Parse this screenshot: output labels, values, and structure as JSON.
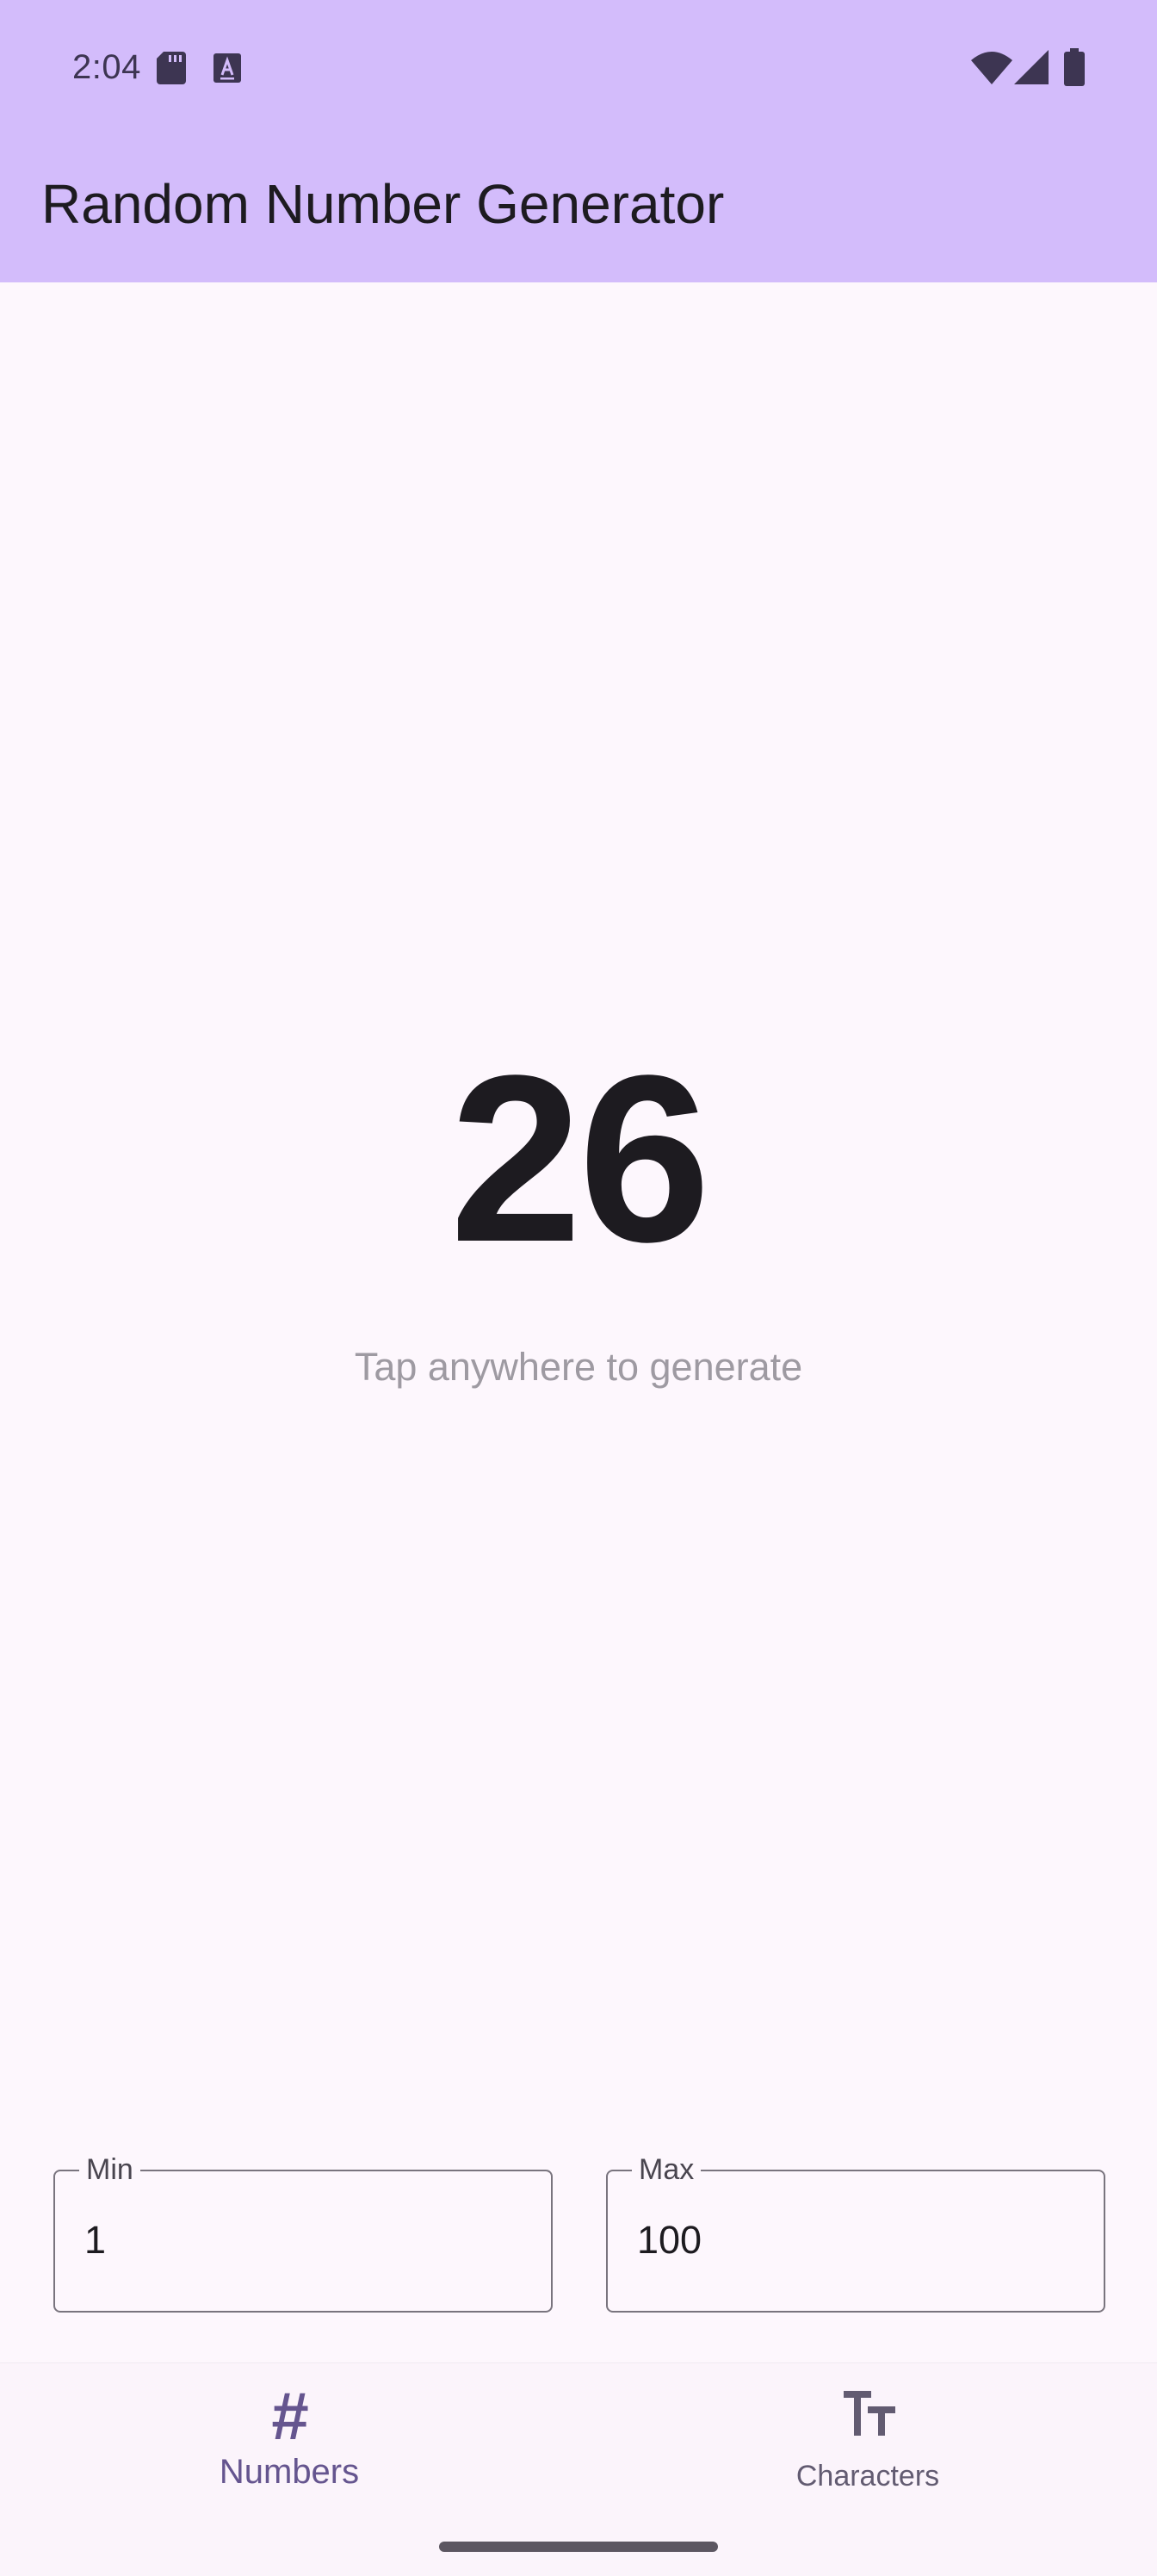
{
  "status_bar": {
    "time": "2:04",
    "icons": [
      "sd-card-icon",
      "text-a-icon",
      "wifi-icon",
      "cellular-signal-icon",
      "battery-icon"
    ]
  },
  "app_bar": {
    "title": "Random Number Generator"
  },
  "main": {
    "result": "26",
    "hint": "Tap anywhere to generate"
  },
  "range": {
    "min_label": "Min",
    "min_value": "1",
    "max_label": "Max",
    "max_value": "100"
  },
  "bottom_nav": {
    "items": [
      {
        "label": "Numbers",
        "icon": "hash-icon",
        "active": true
      },
      {
        "label": "Characters",
        "icon": "text-size-icon",
        "active": false
      }
    ],
    "hash_glyph": "#"
  },
  "colors": {
    "app_bar_bg": "#d3bcfb",
    "background": "#fdf7fd",
    "accent": "#65558f"
  }
}
